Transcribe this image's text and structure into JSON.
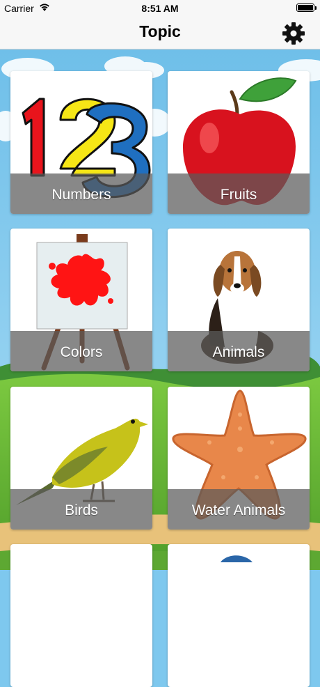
{
  "status_bar": {
    "carrier": "Carrier",
    "time": "8:51 AM"
  },
  "nav": {
    "title": "Topic",
    "settings_icon": "gear-icon"
  },
  "topics": [
    {
      "label": "Numbers",
      "icon": "numbers-123-image"
    },
    {
      "label": "Fruits",
      "icon": "apple-image"
    },
    {
      "label": "Colors",
      "icon": "paint-easel-image"
    },
    {
      "label": "Animals",
      "icon": "dog-image"
    },
    {
      "label": "Birds",
      "icon": "bird-image"
    },
    {
      "label": "Water Animals",
      "icon": "starfish-image"
    }
  ],
  "colors": {
    "sky": "#7ec8ee",
    "grass": "#6fbf3a",
    "path": "#e8c27a",
    "label_overlay": "#5a5a5a"
  }
}
